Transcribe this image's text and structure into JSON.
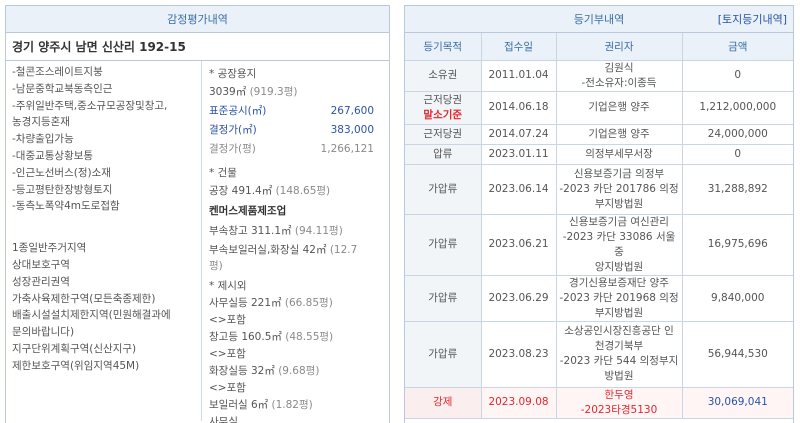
{
  "appraisal": {
    "title": "감정평가내역",
    "address": "경기 양주시 남면 신산리 192-15",
    "notes": [
      "-철콘조스레이트지붕",
      "-남문중학교북동측인근",
      "-주위일반주택,중소규모공장및창고,",
      "농경지등혼재",
      "-차량출입가능",
      "-대중교통상황보통",
      "-인근노선버스(정)소재",
      "-등고평탄한장방형토지",
      "-동측노폭약4m도로접함"
    ],
    "zoning": [
      "1종일반주거지역",
      "상대보호구역",
      "성장관리권역",
      "가축사육제한구역(모든축종제한)",
      "배출시설설치제한지역(민원해결과에",
      "문의바랍니다)",
      "지구단위계획구역(신산지구)",
      "제한보호구역(위임지역45M)"
    ],
    "land": {
      "header": "* 공장용지",
      "area": "3039㎡",
      "area_pyeong": "(919.3평)",
      "official_label": "표준공시(㎡)",
      "official_value": "267,600",
      "decided_label": "결정가(㎡)",
      "decided_value": "383,000",
      "decided_py_label": "결정가(평)",
      "decided_py_value": "1,266,121"
    },
    "building": {
      "header": "* 건물",
      "factory": "공장 491.4㎡",
      "factory_py": "(148.65평)",
      "name": "켄머스제품제조업",
      "annex1": "부속창고 311.1㎡",
      "annex1_py": "(94.11평)",
      "annex2": "부속보일러실,화장실 42㎡",
      "annex2_py": "(12.7",
      "annex2_py2": "평)"
    },
    "excluded": {
      "header": "* 제시외",
      "office": "사무실등 221㎡",
      "office_py": "(66.85평)",
      "inc1": "<>포함",
      "warehouse": "창고등 160.5㎡",
      "warehouse_py": "(48.55평)",
      "inc2": "<>포함",
      "toilet": "화장실등 32㎡",
      "toilet_py": "(9.68평)",
      "inc3": "<>포함",
      "boiler": "보일러실 6㎡",
      "boiler_py": "(1.82평)",
      "cut": "사무실"
    }
  },
  "registry": {
    "title": "등기부내역",
    "land_link": "[토지등기내역]",
    "columns": [
      "등기목적",
      "접수일",
      "권리자",
      "금액"
    ],
    "rows": [
      {
        "purpose": "소유권",
        "date": "2011.01.04",
        "holder": [
          "김원식",
          "-전소유자:이종득"
        ],
        "amount": "0"
      },
      {
        "purpose": "근저당권",
        "tag": "말소기준",
        "date": "2014.06.18",
        "holder": [
          "기업은행 양주"
        ],
        "amount": "1,212,000,000"
      },
      {
        "purpose": "근저당권",
        "date": "2014.07.24",
        "holder": [
          "기업은행 양주"
        ],
        "amount": "24,000,000"
      },
      {
        "purpose": "압류",
        "date": "2023.01.11",
        "holder": [
          "의정부세무서장"
        ],
        "amount": "0"
      },
      {
        "purpose": "가압류",
        "date": "2023.06.14",
        "holder": [
          "신용보증기금 의정부",
          "-2023 카단 201786 의정",
          "부지방법원"
        ],
        "amount": "31,288,892"
      },
      {
        "purpose": "가압류",
        "date": "2023.06.21",
        "holder": [
          "신용보증기금 여신관리",
          "-2023 카단 33086 서울중",
          "앙지방법원"
        ],
        "amount": "16,975,696"
      },
      {
        "purpose": "가압류",
        "date": "2023.06.29",
        "holder": [
          "경기신용보증재단 양주",
          "-2023 카단 201968 의정",
          "부지방법원"
        ],
        "amount": "9,840,000"
      },
      {
        "purpose": "가압류",
        "date": "2023.08.23",
        "holder": [
          "소상공인시장진흥공단 인",
          "천경기북부",
          "-2023 카단 544 의정부지",
          "방법원"
        ],
        "amount": "56,944,530"
      },
      {
        "purpose": "강제",
        "date": "2023.09.08",
        "holder": [
          "한두영",
          "-2023타경5130"
        ],
        "amount": "30,069,041",
        "highlight": true
      }
    ]
  }
}
